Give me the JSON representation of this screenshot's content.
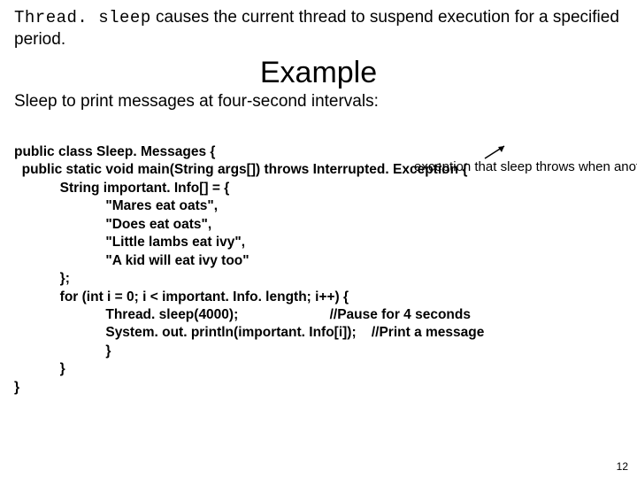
{
  "intro": {
    "mono": "Thread. sleep",
    "rest": " causes the current thread to suspend execution for a specified period."
  },
  "title": "Example",
  "subtitle": "Sleep to print messages at four-second intervals:",
  "code": {
    "l0": "public class Sleep. Messages {",
    "l1": "  public static void main(String args[]) throws Interrupted. Exception {",
    "l2": "            String important. Info[] = {",
    "l3": "                        \"Mares eat oats\",",
    "l4": "                        \"Does eat oats\",",
    "l5": "                        \"Little lambs eat ivy\",",
    "l6": "                        \"A kid will eat ivy too\"",
    "l7": "            };",
    "l8": "            for (int i = 0; i < important. Info. length; i++) {",
    "l9": "                        Thread. sleep(4000);                        //Pause for 4 seconds",
    "l10": "                        System. out. println(important. Info[i]);    //Print a message",
    "l11": "                        }",
    "l12": "            }",
    "l13": "}"
  },
  "annotation": "exception that sleep throws when another thread interrupts current thread while sleep is active. Not caught in sample code.",
  "pagenum": "12"
}
